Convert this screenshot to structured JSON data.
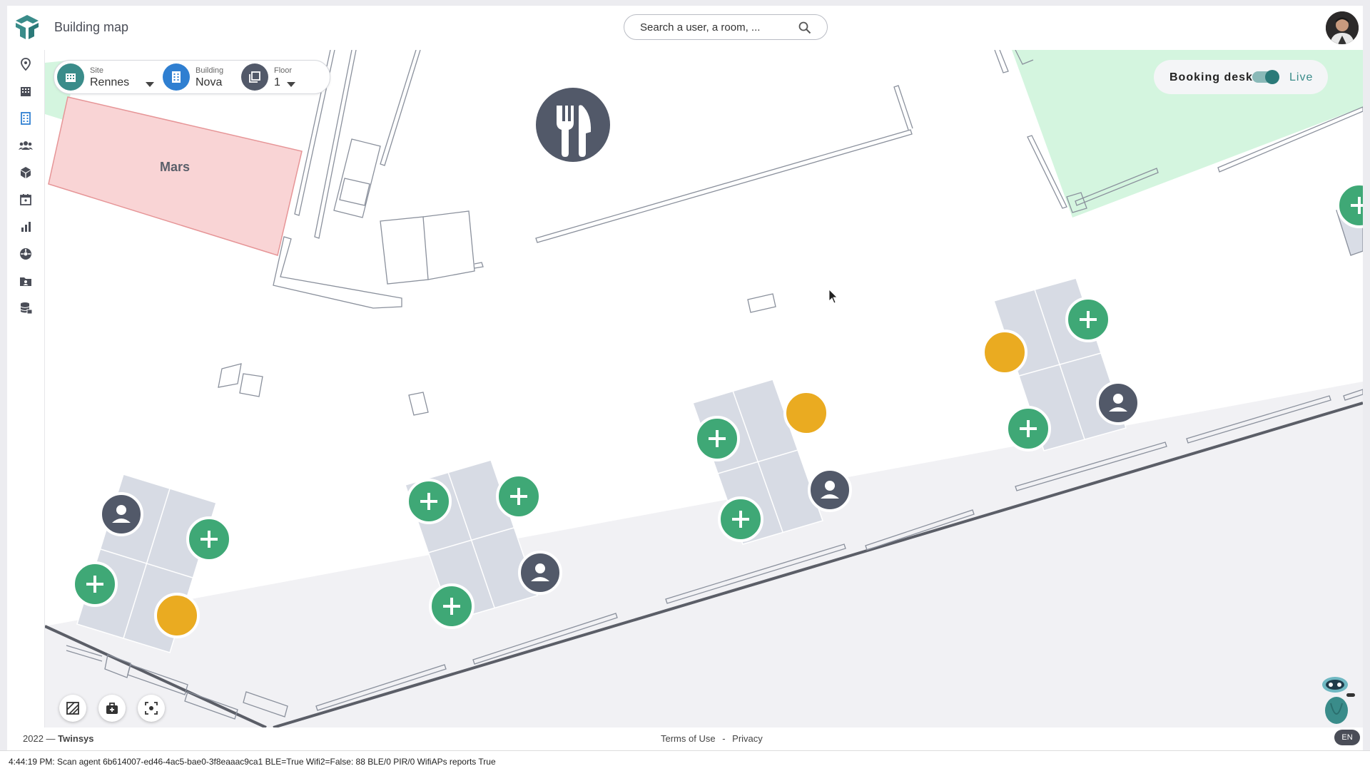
{
  "header": {
    "title": "Building map",
    "search_placeholder": "Search a user, a room, ..."
  },
  "sidebar": {
    "items": [
      {
        "icon": "location-pin-icon"
      },
      {
        "icon": "buildings-icon"
      },
      {
        "icon": "building-map-icon",
        "active": true
      },
      {
        "icon": "people-icon"
      },
      {
        "icon": "cube-icon"
      },
      {
        "icon": "calendar-icon"
      },
      {
        "icon": "bar-chart-icon"
      },
      {
        "icon": "dashboard-icon"
      },
      {
        "icon": "badge-folder-icon"
      },
      {
        "icon": "database-lock-icon"
      }
    ]
  },
  "selector": {
    "site_label": "Site",
    "site_value": "Rennes",
    "building_label": "Building",
    "building_value": "Nova",
    "floor_label": "Floor",
    "floor_value": "1"
  },
  "booking": {
    "label": "Booking desk",
    "live_label": "Live",
    "toggle_on": true
  },
  "map": {
    "room_label": "Mars",
    "desk_status_colors": {
      "available": "#3fa876",
      "occupied": "#525969",
      "booked": "#eaab21"
    }
  },
  "footer": {
    "year": "2022 —",
    "brand": "Twinsys",
    "terms": "Terms of Use",
    "separator": "-",
    "privacy": "Privacy",
    "language": "EN"
  },
  "status_bar": "4:44:19 PM: Scan agent 6b614007-ed46-4ac5-bae0-3f8eaaac9ca1 BLE=True Wifi2=False: 88 BLE/0 PIR/0 WifiAPs reports True"
}
